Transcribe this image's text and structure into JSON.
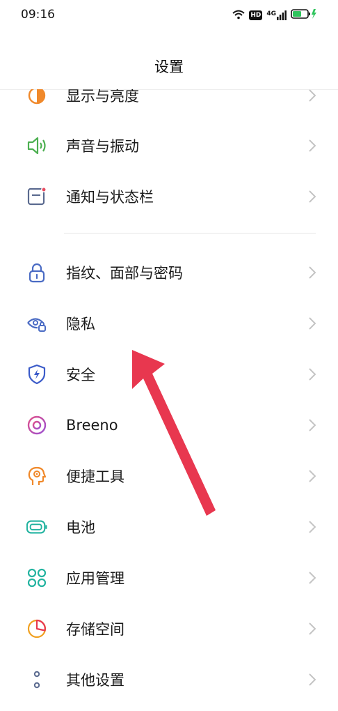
{
  "status": {
    "time": "09:16",
    "hd": "HD",
    "network": "4G"
  },
  "title": "设置",
  "rows": [
    {
      "label": "显示与亮度",
      "icon": "display-brightness-icon"
    },
    {
      "label": "声音与振动",
      "icon": "speaker-icon"
    },
    {
      "label": "通知与状态栏",
      "icon": "notification-icon"
    },
    {
      "label": "指纹、面部与密码",
      "icon": "lock-icon"
    },
    {
      "label": "隐私",
      "icon": "privacy-eye-icon"
    },
    {
      "label": "安全",
      "icon": "security-shield-icon"
    },
    {
      "label": "Breeno",
      "icon": "breeno-icon"
    },
    {
      "label": "便捷工具",
      "icon": "convenience-tools-icon"
    },
    {
      "label": "电池",
      "icon": "battery-icon"
    },
    {
      "label": "应用管理",
      "icon": "app-management-icon"
    },
    {
      "label": "存储空间",
      "icon": "storage-icon"
    },
    {
      "label": "其他设置",
      "icon": "more-settings-icon"
    }
  ],
  "colors": {
    "accent_arrow": "#e8374f",
    "chevron": "#c4c4c4"
  }
}
